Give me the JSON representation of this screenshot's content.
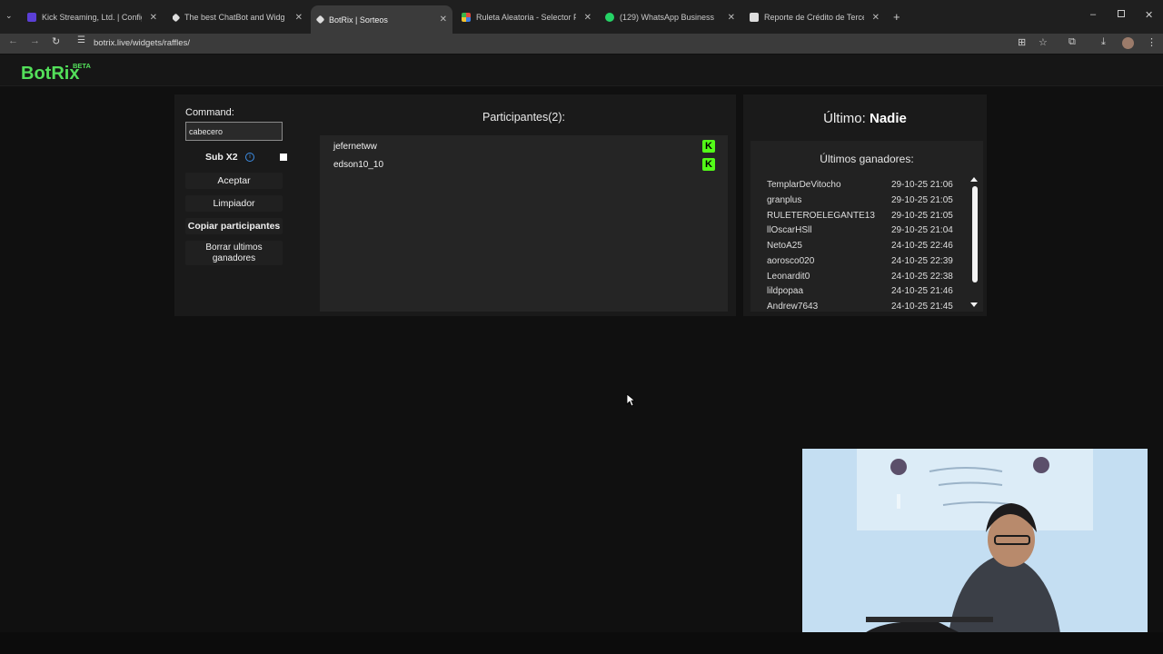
{
  "browser": {
    "tabs": [
      {
        "label": "Kick Streaming, Ltd. | Configura",
        "icon": "kick-favicon",
        "color": "#5b3fd6"
      },
      {
        "label": "The best ChatBot and Widgets",
        "icon": "botrix-favicon",
        "color": "#dddddd"
      },
      {
        "label": "BotRix | Sorteos",
        "icon": "botrix-favicon",
        "color": "#dddddd",
        "active": true
      },
      {
        "label": "Ruleta Aleatoria - Selector Pers",
        "icon": "wheel-favicon",
        "color": "#e24a3b"
      },
      {
        "label": "(129) WhatsApp Business",
        "icon": "whatsapp-favicon",
        "color": "#25d366"
      },
      {
        "label": "Reporte de Crédito de Tercero",
        "icon": "doc-favicon",
        "color": "#dddddd"
      }
    ],
    "url": "botrix.live/widgets/raffles/"
  },
  "site": {
    "logo": "BotRix",
    "beta": "BETA"
  },
  "raffle": {
    "command_label": "Command:",
    "command_value": "cabecero",
    "sub_label": "Sub X2",
    "accept_label": "Aceptar",
    "clean_label": "Limpiador",
    "copy_label": "Copiar participantes",
    "delete_label": "Borrar ultimos ganadores",
    "participants_title": "Participantes(2):",
    "participants": [
      "jefernetww",
      "edson10_10"
    ]
  },
  "winners": {
    "last_label": "Último:",
    "last_value": "Nadie",
    "title": "Últimos ganadores:",
    "rows": [
      {
        "name": "TemplarDeVitocho",
        "date": "29-10-25 21:06"
      },
      {
        "name": "granplus",
        "date": "29-10-25 21:05"
      },
      {
        "name": "RULETEROELEGANTE13",
        "date": "29-10-25 21:05"
      },
      {
        "name": "llOscarHSll",
        "date": "29-10-25 21:04"
      },
      {
        "name": "NetoA25",
        "date": "24-10-25 22:46"
      },
      {
        "name": "aorosco020",
        "date": "24-10-25 22:39"
      },
      {
        "name": "Leonardit0",
        "date": "24-10-25 22:38"
      },
      {
        "name": "lildpopaa",
        "date": "24-10-25 21:46"
      },
      {
        "name": "Andrew7643",
        "date": "24-10-25 21:45"
      }
    ]
  },
  "colors": {
    "brand_green": "#53e05a",
    "kick_green": "#53fc18",
    "background": "#101010"
  }
}
